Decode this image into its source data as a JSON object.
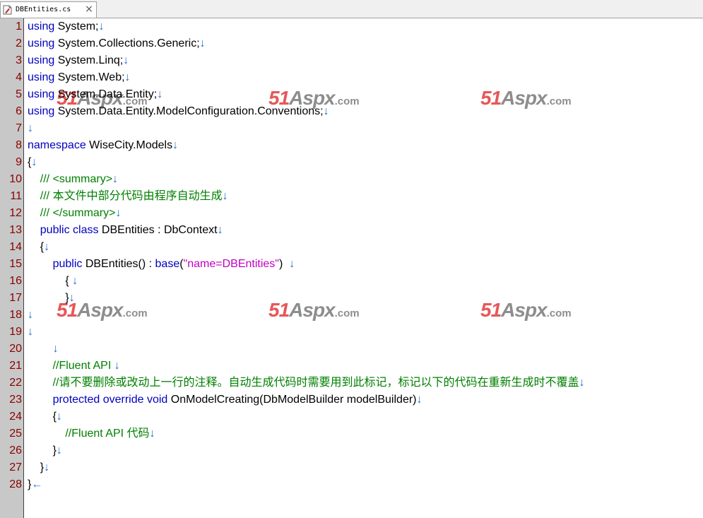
{
  "tab": {
    "label": "DBEntities.cs",
    "close": "×",
    "icon": "file-cs-icon"
  },
  "newline_glyph": "↓",
  "eof_glyph": "←",
  "watermark": {
    "brand": "51",
    "brand2": "Aspx",
    "domain": ".com"
  },
  "colors": {
    "keyword": "#0000c0",
    "comment": "#008000",
    "string": "#c000c0",
    "line_number": "#8b0000",
    "newline_mark": "#1e6fd0"
  },
  "lines": [
    {
      "n": "1",
      "parts": [
        [
          "kw",
          "using"
        ],
        [
          "t",
          " System;"
        ],
        [
          "nl",
          "↓"
        ]
      ]
    },
    {
      "n": "2",
      "parts": [
        [
          "kw",
          "using"
        ],
        [
          "t",
          " System.Collections.Generic;"
        ],
        [
          "nl",
          "↓"
        ]
      ]
    },
    {
      "n": "3",
      "parts": [
        [
          "kw",
          "using"
        ],
        [
          "t",
          " System.Linq;"
        ],
        [
          "nl",
          "↓"
        ]
      ]
    },
    {
      "n": "4",
      "parts": [
        [
          "kw",
          "using"
        ],
        [
          "t",
          " System.Web;"
        ],
        [
          "nl",
          "↓"
        ]
      ]
    },
    {
      "n": "5",
      "parts": [
        [
          "kw",
          "using"
        ],
        [
          "t",
          " System.Data.Entity;"
        ],
        [
          "nl",
          "↓"
        ]
      ]
    },
    {
      "n": "6",
      "parts": [
        [
          "kw",
          "using"
        ],
        [
          "t",
          " System.Data.Entity.ModelConfiguration.Conventions;"
        ],
        [
          "nl",
          "↓"
        ]
      ]
    },
    {
      "n": "7",
      "parts": [
        [
          "nl",
          "↓"
        ]
      ]
    },
    {
      "n": "8",
      "parts": [
        [
          "kw",
          "namespace"
        ],
        [
          "t",
          " WiseCity.Models"
        ],
        [
          "nl",
          "↓"
        ]
      ]
    },
    {
      "n": "9",
      "parts": [
        [
          "t",
          "{"
        ],
        [
          "nl",
          "↓"
        ]
      ]
    },
    {
      "n": "10",
      "parts": [
        [
          "t",
          "    "
        ],
        [
          "cm",
          "/// <summary>"
        ],
        [
          "nl",
          "↓"
        ]
      ]
    },
    {
      "n": "11",
      "parts": [
        [
          "t",
          "    "
        ],
        [
          "cm",
          "/// 本文件中部分代码由程序自动生成"
        ],
        [
          "nl",
          "↓"
        ]
      ]
    },
    {
      "n": "12",
      "parts": [
        [
          "t",
          "    "
        ],
        [
          "cm",
          "/// </summary>"
        ],
        [
          "nl",
          "↓"
        ]
      ]
    },
    {
      "n": "13",
      "parts": [
        [
          "t",
          "    "
        ],
        [
          "kw",
          "public class"
        ],
        [
          "t",
          " DBEntities : DbContext"
        ],
        [
          "nl",
          "↓"
        ]
      ]
    },
    {
      "n": "14",
      "parts": [
        [
          "t",
          "    {"
        ],
        [
          "nl",
          "↓"
        ]
      ]
    },
    {
      "n": "15",
      "parts": [
        [
          "t",
          "        "
        ],
        [
          "kw",
          "public"
        ],
        [
          "t",
          " DBEntities() : "
        ],
        [
          "kw",
          "base"
        ],
        [
          "t",
          "("
        ],
        [
          "str",
          "\"name=DBEntities\""
        ],
        [
          "t",
          ")  "
        ],
        [
          "nl",
          "↓"
        ]
      ]
    },
    {
      "n": "16",
      "parts": [
        [
          "t",
          "            { "
        ],
        [
          "nl",
          "↓"
        ]
      ]
    },
    {
      "n": "17",
      "parts": [
        [
          "t",
          "            }"
        ],
        [
          "nl",
          "↓"
        ]
      ]
    },
    {
      "n": "18",
      "parts": [
        [
          "nl",
          "↓"
        ]
      ]
    },
    {
      "n": "19",
      "parts": [
        [
          "nl",
          "↓"
        ]
      ]
    },
    {
      "n": "20",
      "parts": [
        [
          "t",
          "        "
        ],
        [
          "nl",
          "↓"
        ]
      ]
    },
    {
      "n": "21",
      "parts": [
        [
          "t",
          "        "
        ],
        [
          "cm",
          "//Fluent API "
        ],
        [
          "nl",
          "↓"
        ]
      ]
    },
    {
      "n": "22",
      "parts": [
        [
          "t",
          "        "
        ],
        [
          "cm",
          "//请不要删除或改动上一行的注释。自动生成代码时需要用到此标记，标记以下的代码在重新生成时不覆盖"
        ],
        [
          "nl",
          "↓"
        ]
      ]
    },
    {
      "n": "23",
      "parts": [
        [
          "t",
          "        "
        ],
        [
          "kw",
          "protected override void"
        ],
        [
          "t",
          " OnModelCreating(DbModelBuilder modelBuilder)"
        ],
        [
          "nl",
          "↓"
        ]
      ]
    },
    {
      "n": "24",
      "parts": [
        [
          "t",
          "        {"
        ],
        [
          "nl",
          "↓"
        ]
      ]
    },
    {
      "n": "25",
      "parts": [
        [
          "t",
          "            "
        ],
        [
          "cm",
          "//Fluent API 代码"
        ],
        [
          "nl",
          "↓"
        ]
      ]
    },
    {
      "n": "26",
      "parts": [
        [
          "t",
          "        }"
        ],
        [
          "nl",
          "↓"
        ]
      ]
    },
    {
      "n": "27",
      "parts": [
        [
          "t",
          "    }"
        ],
        [
          "nl",
          "↓"
        ]
      ]
    },
    {
      "n": "28",
      "parts": [
        [
          "t",
          "}"
        ],
        [
          "nl",
          "←"
        ]
      ]
    }
  ]
}
